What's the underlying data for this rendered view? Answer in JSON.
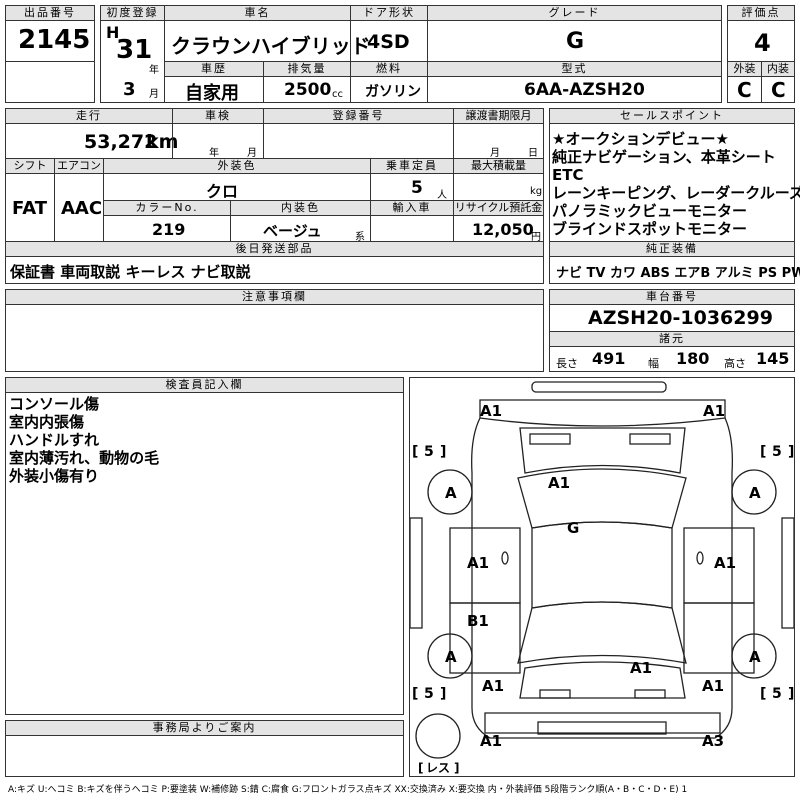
{
  "header_labels": {
    "lot": "出品番号",
    "first_reg": "初度登録",
    "car_name": "車名",
    "door": "ドア形状",
    "grade": "グレード",
    "score": "評価点",
    "history": "車歴",
    "displacement": "排気量",
    "fuel": "燃料",
    "model": "型式",
    "exterior": "外装",
    "interior": "内装"
  },
  "lot_number": "2145",
  "first_reg": {
    "era": "H",
    "year": "31",
    "year_unit": "年",
    "month": "3",
    "month_unit": "月"
  },
  "car_name": "クラウンハイブリッド",
  "door_type": "4SD",
  "grade": "G",
  "score": "4",
  "history": "自家用",
  "displacement": "2500",
  "displacement_unit": "cc",
  "fuel": "ガソリン",
  "model_type": "6AA-AZSH20",
  "exterior_score": "C",
  "interior_score": "C",
  "row2_labels": {
    "mileage": "走行",
    "inspection": "車検",
    "registration_no": "登録番号",
    "transfer_docs": "譲渡書期限月",
    "shift": "シフト",
    "aircon": "エアコン",
    "exterior_color": "外装色",
    "capacity": "乗車定員",
    "max_load": "最大積載量",
    "color_no": "カラーNo.",
    "interior_color": "内装色",
    "import": "輸入車",
    "recycle": "リサイクル預託金",
    "later_parts": "後日発送部品",
    "notes": "注意事項欄",
    "sales_points": "セールスポイント",
    "equipment": "純正装備",
    "chassis": "車台番号",
    "specs": "諸元",
    "inspector": "検査員記入欄",
    "office": "事務局よりご案内"
  },
  "mileage": "53,272",
  "mileage_unit": "km",
  "inspection_units": {
    "year": "年",
    "month": "月"
  },
  "transfer_units": {
    "month": "月",
    "day": "日"
  },
  "shift": "FAT",
  "aircon": "AAC",
  "exterior_color": "クロ",
  "capacity": "5",
  "capacity_unit": "人",
  "max_load_unit": "kg",
  "color_no": "219",
  "interior_color": "ベージュ",
  "interior_color_suffix": "系",
  "recycle_fee": "12,050",
  "recycle_unit": "円",
  "later_parts": "保証書 車両取説 キーレス ナビ取説",
  "sales_points": [
    "★オークションデビュー★",
    "純正ナビゲーション、本革シート",
    "ETC",
    "レーンキーピング、レーダークルーズ",
    "パノラミックビューモニター",
    "ブラインドスポットモニター"
  ],
  "equipment": "ナビ TV カワ ABS エアB アルミ PS PW",
  "chassis_number": "AZSH20-1036299",
  "specs": {
    "length_label": "長さ",
    "length": "491",
    "width_label": "幅",
    "width": "180",
    "height_label": "高さ",
    "height": "145"
  },
  "inspector_remarks": [
    "コンソール傷",
    "室内内張傷",
    "ハンドルすれ",
    "室内薄汚れ、動物の毛",
    "外装小傷有り"
  ],
  "diagram": {
    "marks": {
      "fl_corner": "A1",
      "fr_corner": "A1",
      "hood": "A1",
      "roof": "G",
      "front_tire_l": "A",
      "front_tire_r": "A",
      "rear_tire_l": "A",
      "rear_tire_r": "A",
      "fl_door": "A1",
      "fr_door": "A1",
      "rl_door": "B1",
      "rr_door": "A1",
      "trunk": "A1",
      "rl_quarter": "A1",
      "rr_quarter": "A1",
      "rear_bumper_l": "A1",
      "rear_bumper_r": "A3"
    },
    "tire_depths": {
      "fl": "5",
      "fr": "5",
      "rl": "5",
      "rr": "5"
    },
    "spare_label": "レス"
  },
  "legend": "A:キズ U:ヘコミ B:キズを伴うヘコミ P:要塗装 W:補修跡 S:錆 C:腐食 G:フロントガラス点キズ XX:交換済み X:要交換 内・外装評価 5段階ランク順(A・B・C・D・E) 1"
}
